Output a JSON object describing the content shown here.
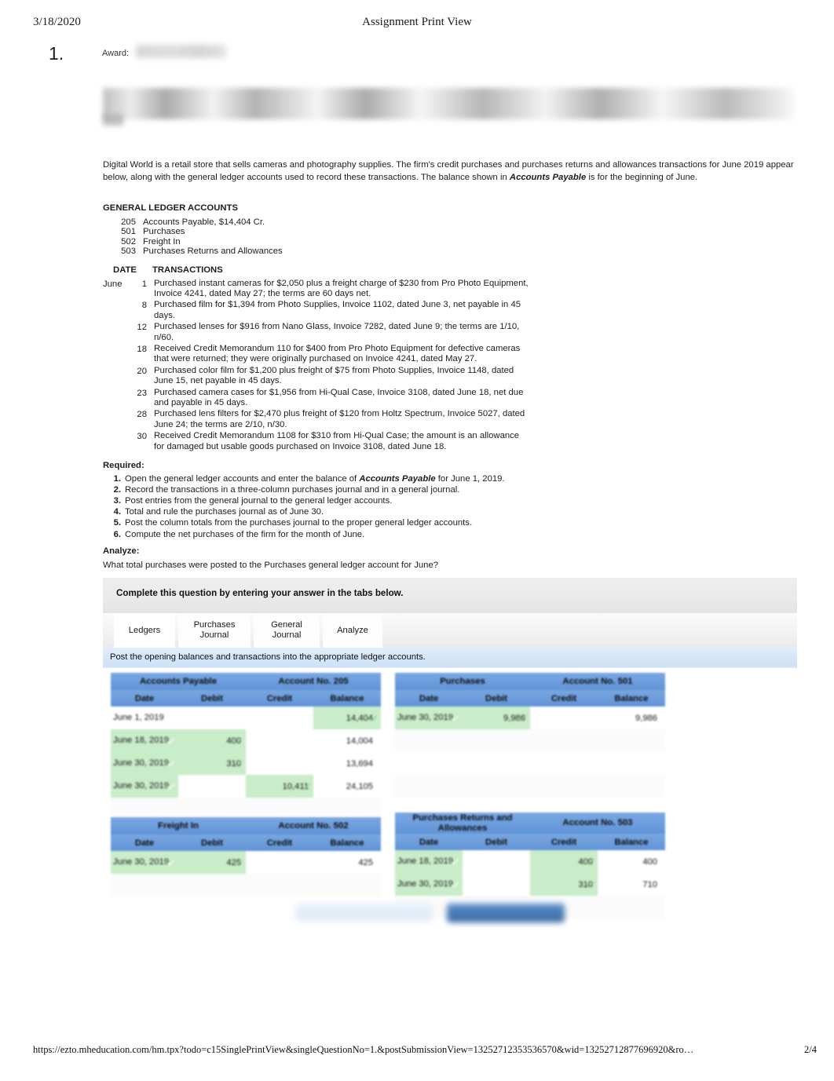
{
  "print": {
    "date": "3/18/2020",
    "title": "Assignment Print View",
    "footer_url": "https://ezto.mheducation.com/hm.tpx?todo=c15SinglePrintView&singleQuestionNo=1.&postSubmissionView=13252712353536570&wid=13252712877696920&ro…",
    "page_label": "2/4"
  },
  "question": {
    "number": "1.",
    "award_label": "Award:"
  },
  "intro": {
    "part1": "Digital World is a retail store that sells cameras and photography supplies. The firm's credit purchases and purchases returns and allowances transactions for June 2019 appear below, along with the general ledger accounts used to record these transactions. The balance shown in ",
    "emphasis": "Accounts Payable",
    "part2": " is for the beginning of June."
  },
  "general_ledger": {
    "heading": "GENERAL LEDGER ACCOUNTS",
    "accounts": [
      {
        "no": "205",
        "name": "Accounts Payable, $14,404 Cr."
      },
      {
        "no": "501",
        "name": "Purchases"
      },
      {
        "no": "502",
        "name": "Freight In"
      },
      {
        "no": "503",
        "name": "Purchases Returns and Allowances"
      }
    ]
  },
  "transactions": {
    "col_date": "DATE",
    "col_transactions": "TRANSACTIONS",
    "rows": [
      {
        "month": "June",
        "day": "1",
        "text": "Purchased instant cameras for $2,050 plus a freight charge of $230 from Pro Photo Equipment, Invoice 4241, dated May 27; the terms are 60 days net."
      },
      {
        "month": "",
        "day": "8",
        "text": "Purchased film for $1,394 from Photo Supplies, Invoice 1102, dated June 3, net payable in 45 days."
      },
      {
        "month": "",
        "day": "12",
        "text": "Purchased lenses for $916 from Nano Glass, Invoice 7282, dated June 9; the terms are 1/10, n/60."
      },
      {
        "month": "",
        "day": "18",
        "text": "Received Credit Memorandum 110 for $400 from Pro Photo Equipment for defective cameras that were returned; they were originally purchased on Invoice 4241, dated May 27."
      },
      {
        "month": "",
        "day": "20",
        "text": "Purchased color film for $1,200 plus freight of $75 from Photo Supplies, Invoice 1148, dated June 15, net payable in 45 days."
      },
      {
        "month": "",
        "day": "23",
        "text": "Purchased camera cases for $1,956 from Hi-Qual Case, Invoice 3108, dated June 18, net due and payable in 45 days."
      },
      {
        "month": "",
        "day": "28",
        "text": "Purchased lens filters for $2,470 plus freight of $120 from Holtz Spectrum, Invoice 5027, dated June 24; the terms are 2/10, n/30."
      },
      {
        "month": "",
        "day": "30",
        "text": "Received Credit Memorandum 1108 for $310 from Hi-Qual Case; the amount is an allowance for damaged but usable goods purchased on Invoice 3108, dated June 18."
      }
    ]
  },
  "required": {
    "heading": "Required:",
    "items": [
      {
        "n": "1.",
        "pre": "Open the general ledger accounts and enter the balance of ",
        "em": "Accounts Payable",
        "post": " for June 1, 2019."
      },
      {
        "n": "2.",
        "pre": "Record the transactions in a three-column purchases journal and in a general journal.",
        "em": "",
        "post": ""
      },
      {
        "n": "3.",
        "pre": "Post entries from the general journal to the general ledger accounts.",
        "em": "",
        "post": ""
      },
      {
        "n": "4.",
        "pre": "Total and rule the purchases journal as of June 30.",
        "em": "",
        "post": ""
      },
      {
        "n": "5.",
        "pre": "Post the column totals from the purchases journal to the proper general ledger accounts.",
        "em": "",
        "post": ""
      },
      {
        "n": "6.",
        "pre": "Compute the net purchases of the firm for the month of June.",
        "em": "",
        "post": ""
      }
    ]
  },
  "analyze": {
    "heading": "Analyze:",
    "question": "What total purchases were posted to the Purchases general ledger account for June?"
  },
  "widget": {
    "banner": "Complete this question by entering your answer in the tabs below.",
    "tabs": [
      {
        "label_line1": "Ledgers",
        "label_line2": "",
        "active": true
      },
      {
        "label_line1": "Purchases",
        "label_line2": "Journal",
        "active": false
      },
      {
        "label_line1": "General",
        "label_line2": "Journal",
        "active": false
      },
      {
        "label_line1": "Analyze",
        "label_line2": "",
        "active": false
      }
    ],
    "instruction": "Post the opening balances and transactions into the appropriate ledger accounts.",
    "columns": [
      "Date",
      "Debit",
      "Credit",
      "Balance"
    ],
    "ledgers": [
      {
        "name": "Accounts Payable",
        "account_no": "Account No. 205",
        "rows": [
          {
            "date": "June 1, 2019",
            "debit": "",
            "credit": "",
            "balance": "14,404",
            "date_hl": false,
            "debit_hl": false,
            "credit_hl": false,
            "balance_hl": true
          },
          {
            "date": "June 18, 2019",
            "debit": "400",
            "credit": "",
            "balance": "14,004",
            "date_hl": true,
            "debit_hl": true,
            "credit_hl": false,
            "balance_hl": false
          },
          {
            "date": "June 30, 2019",
            "debit": "310",
            "credit": "",
            "balance": "13,694",
            "date_hl": true,
            "debit_hl": true,
            "credit_hl": false,
            "balance_hl": false
          },
          {
            "date": "June 30, 2019",
            "debit": "",
            "credit": "10,411",
            "balance": "24,105",
            "date_hl": true,
            "debit_hl": false,
            "credit_hl": true,
            "balance_hl": false
          }
        ],
        "blank_rows": 1
      },
      {
        "name": "Purchases",
        "account_no": "Account No. 501",
        "rows": [
          {
            "date": "June 30, 2019",
            "debit": "9,986",
            "credit": "",
            "balance": "9,986",
            "date_hl": true,
            "debit_hl": true,
            "credit_hl": false,
            "balance_hl": false
          }
        ],
        "blank_rows": 4
      },
      {
        "name": "Freight In",
        "account_no": "Account No. 502",
        "rows": [
          {
            "date": "June 30, 2019",
            "debit": "425",
            "credit": "",
            "balance": "425",
            "date_hl": true,
            "debit_hl": true,
            "credit_hl": false,
            "balance_hl": false
          }
        ],
        "blank_rows": 2
      },
      {
        "name": "Purchases Returns and Allowances",
        "account_no": "Account No. 503",
        "rows": [
          {
            "date": "June 18, 2019",
            "debit": "",
            "credit": "400",
            "balance": "400",
            "date_hl": true,
            "debit_hl": false,
            "credit_hl": true,
            "balance_hl": false
          },
          {
            "date": "June 30, 2019",
            "debit": "",
            "credit": "310",
            "balance": "710",
            "date_hl": true,
            "debit_hl": false,
            "credit_hl": true,
            "balance_hl": false
          }
        ],
        "blank_rows": 1
      }
    ]
  },
  "colors": {
    "header_blue": "#6b9cdb",
    "highlight_green": "#c9ecc9",
    "subbar_blue": "#d5e6f8",
    "primary_button": "#37679f"
  }
}
